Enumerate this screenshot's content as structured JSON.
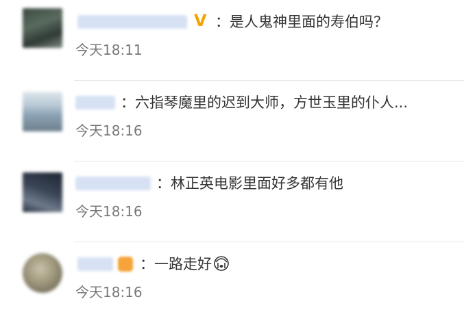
{
  "comments": [
    {
      "separator": "：",
      "text": "是人鬼神里面的寿伯吗？",
      "time": "今天18:11",
      "badge": "vip-v-badge"
    },
    {
      "separator": "：",
      "text": "六指琴魔里的迟到大师，方世玉里的仆人...",
      "time": "今天18:16"
    },
    {
      "separator": "：",
      "text": "林正英电影里面好多都有他",
      "time": "今天18:16"
    },
    {
      "separator": "：",
      "text": "一路走好",
      "time": "今天18:16",
      "badge": "orange-member-badge",
      "emoji": "crying-emoji"
    }
  ],
  "colors": {
    "vip_badge": "#f5a300",
    "timestamp": "#777777",
    "text": "#333333",
    "divider": "#e6e6e6"
  }
}
